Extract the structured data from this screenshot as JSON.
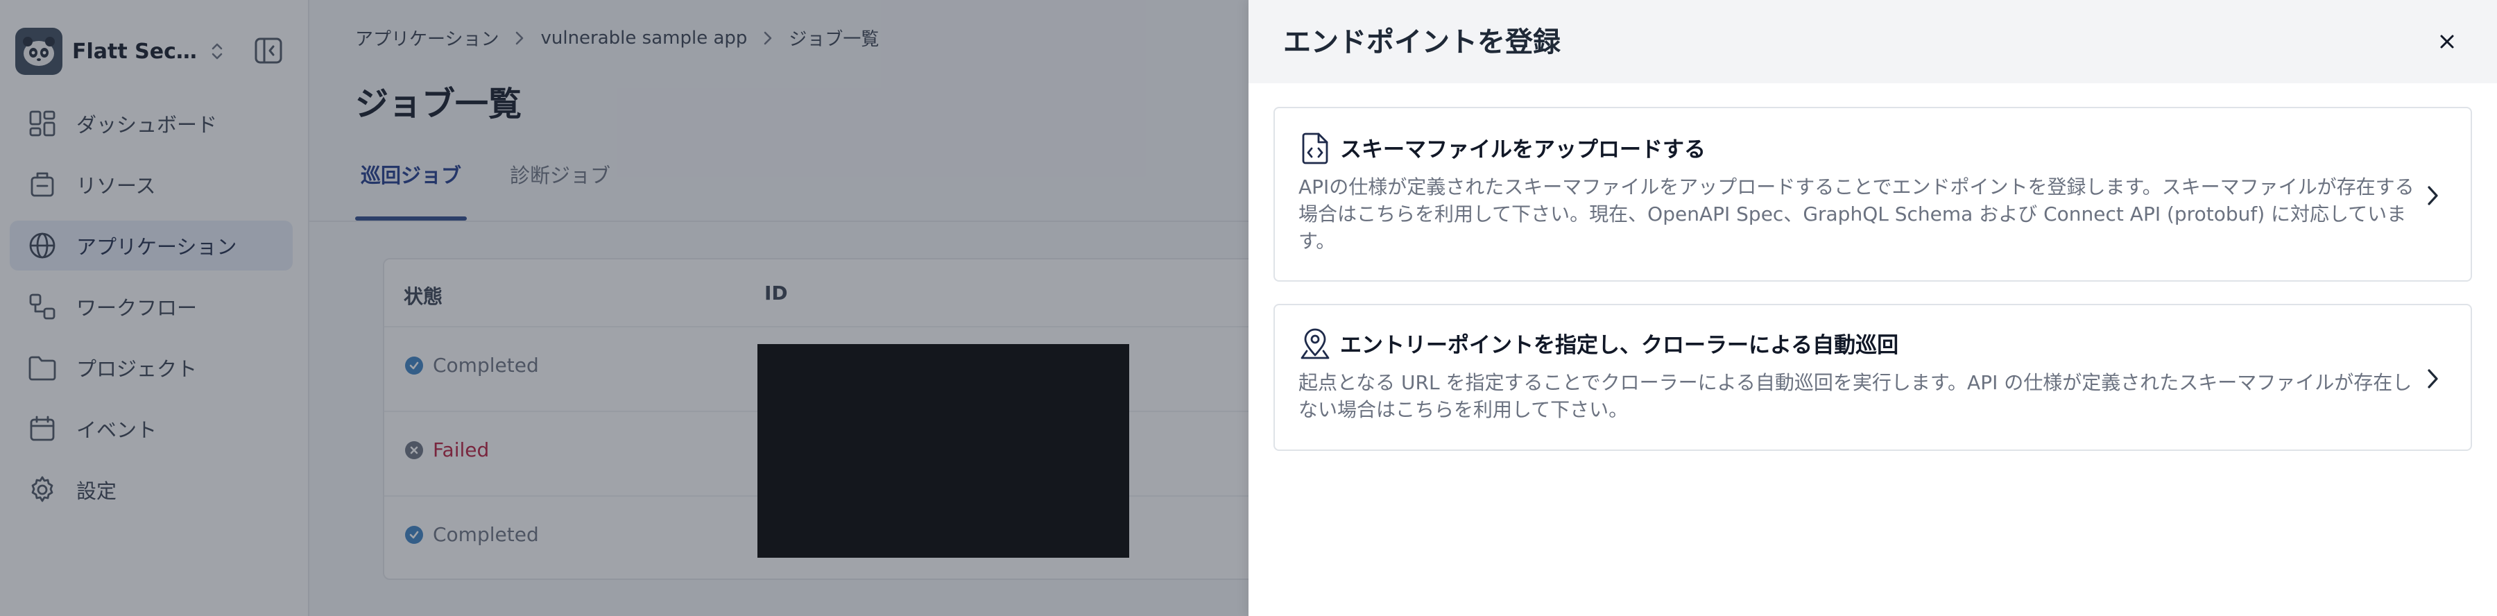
{
  "sidebar": {
    "org_name": "Flatt Security Inc.",
    "items": [
      {
        "label": "ダッシュボード",
        "icon": "dashboard-icon"
      },
      {
        "label": "リソース",
        "icon": "resource-icon"
      },
      {
        "label": "アプリケーション",
        "icon": "globe-icon",
        "active": true
      },
      {
        "label": "ワークフロー",
        "icon": "workflow-icon"
      },
      {
        "label": "プロジェクト",
        "icon": "folder-icon"
      },
      {
        "label": "イベント",
        "icon": "calendar-icon"
      },
      {
        "label": "設定",
        "icon": "gear-icon"
      }
    ]
  },
  "breadcrumb": [
    "アプリケーション",
    "vulnerable sample app",
    "ジョブ一覧"
  ],
  "page": {
    "title": "ジョブ一覧",
    "tabs": [
      {
        "label": "巡回ジョブ",
        "active": true
      },
      {
        "label": "診断ジョブ",
        "active": false
      }
    ]
  },
  "table": {
    "headers": [
      "状態",
      "ID"
    ],
    "rows": [
      {
        "status": "Completed"
      },
      {
        "status": "Failed"
      },
      {
        "status": "Completed"
      }
    ]
  },
  "drawer": {
    "title": "エンドポイントを登録",
    "options": [
      {
        "title": "スキーマファイルをアップロードする",
        "description": "APIの仕様が定義されたスキーマファイルをアップロードすることでエンドポイントを登録します。スキーマファイルが存在する場合はこちらを利用して下さい。現在、OpenAPI Spec、GraphQL Schema および Connect API (protobuf) に対応しています。",
        "icon": "file-code-icon"
      },
      {
        "title": "エントリーポイントを指定し、クローラーによる自動巡回",
        "description": "起点となる URL を指定することでクローラーによる自動巡回を実行します。API の仕様が定義されたスキーマファイルが存在しない場合はこちらを利用して下さい。",
        "icon": "map-pin-icon"
      }
    ]
  },
  "colors": {
    "accent": "#2d4a8a",
    "completed": "#3b82c4",
    "failed": "#b91c3c",
    "overlay": "#2c3240"
  }
}
